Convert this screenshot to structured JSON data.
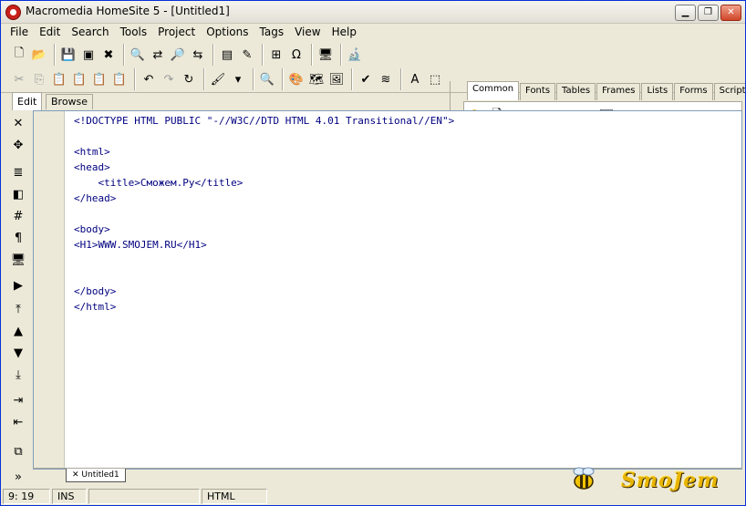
{
  "window": {
    "title": "Macromedia HomeSite 5 - [Untitled1]"
  },
  "menu": [
    "File",
    "Edit",
    "Search",
    "Tools",
    "Project",
    "Options",
    "Tags",
    "View",
    "Help"
  ],
  "tag_tabs": [
    "Common",
    "Fonts",
    "Tables",
    "Frames",
    "Lists",
    "Forms",
    "Script"
  ],
  "tag_tools": {
    "nb": "nb"
  },
  "edit_tabs": {
    "edit": "Edit",
    "browse": "Browse"
  },
  "code_lines": [
    "<!DOCTYPE HTML PUBLIC \"-//W3C//DTD HTML 4.01 Transitional//EN\">",
    "",
    "<html>",
    "<head>",
    "    <title>Сможем.Ру</title>",
    "</head>",
    "",
    "<body>",
    "<H1>WWW.SMOJEM.RU</H1>",
    "",
    "",
    "</body>",
    "</html>"
  ],
  "doc_tab": "Untitled1",
  "status": {
    "position": "9: 19",
    "mode": "INS",
    "doc_type": "HTML"
  },
  "watermark": "SmoJem",
  "colors": {
    "accent": "#0831d9",
    "code": "#000080",
    "chrome": "#ece9d8"
  }
}
